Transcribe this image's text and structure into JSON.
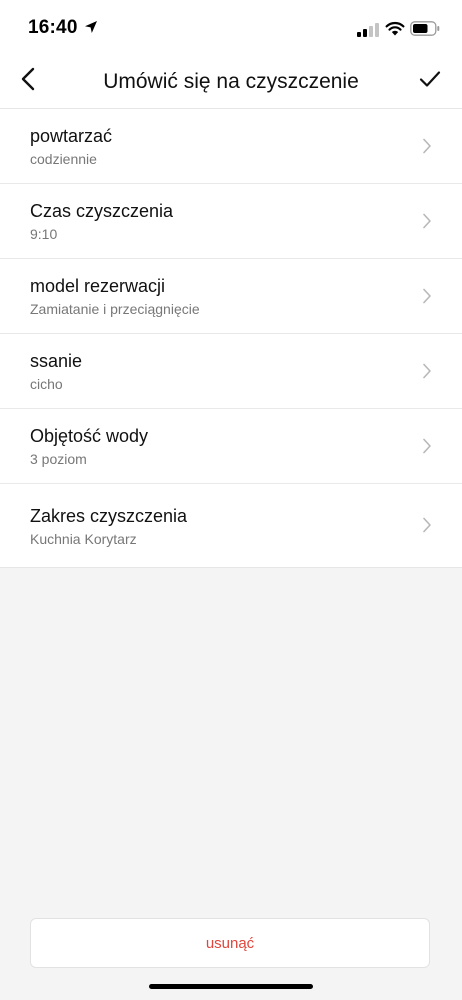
{
  "status_bar": {
    "time": "16:40",
    "location_icon": "location-arrow-icon",
    "signal_icon": "cellular-signal-icon",
    "wifi_icon": "wifi-icon",
    "battery_icon": "battery-icon"
  },
  "nav": {
    "title": "Umówić się na czyszczenie",
    "back_icon": "chevron-left-icon",
    "confirm_icon": "checkmark-icon"
  },
  "items": [
    {
      "title": "powtarzać",
      "value": "codziennie"
    },
    {
      "title": "Czas czyszczenia",
      "value": "9:10"
    },
    {
      "title": "model rezerwacji",
      "value": "Zamiatanie i przeciągnięcie"
    },
    {
      "title": "ssanie",
      "value": "cicho"
    },
    {
      "title": "Objętość wody",
      "value": "3 poziom"
    },
    {
      "title": "Zakres czyszczenia",
      "value": "Kuchnia Korytarz"
    }
  ],
  "delete_label": "usunąć",
  "colors": {
    "accent_delete": "#e0463c",
    "background": "#f4f4f4",
    "surface": "#ffffff"
  }
}
